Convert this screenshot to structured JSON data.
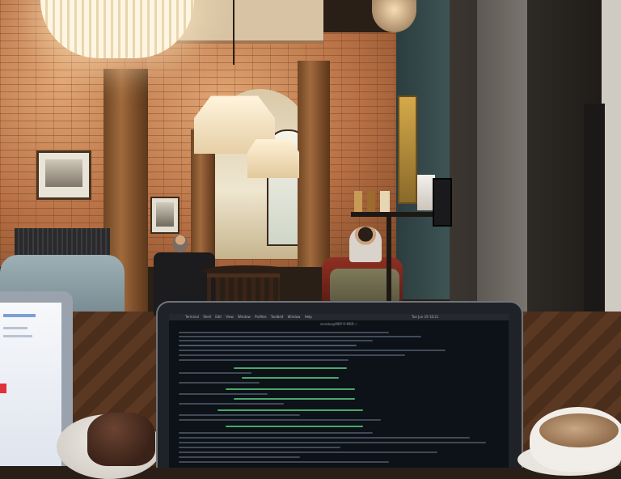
{
  "scene": {
    "description_free": true,
    "colors": {
      "brick_wall": "#b9774a",
      "teal_wall": "#33484a",
      "dark_panel": "#2e2a26",
      "wood_floor": "#4a2e1b",
      "sofa": "#8a9ea6",
      "laptop_screen": "#0d1118"
    }
  },
  "laptop_menu": {
    "items": [
      "Terminal",
      "Shell",
      "Edit",
      "View",
      "Window",
      "Profiles",
      "Toolbelt",
      "Window",
      "Help"
    ],
    "title": "zenoba@MBP-R-MBR:~",
    "status": "Tue Jun 19 10:21"
  }
}
